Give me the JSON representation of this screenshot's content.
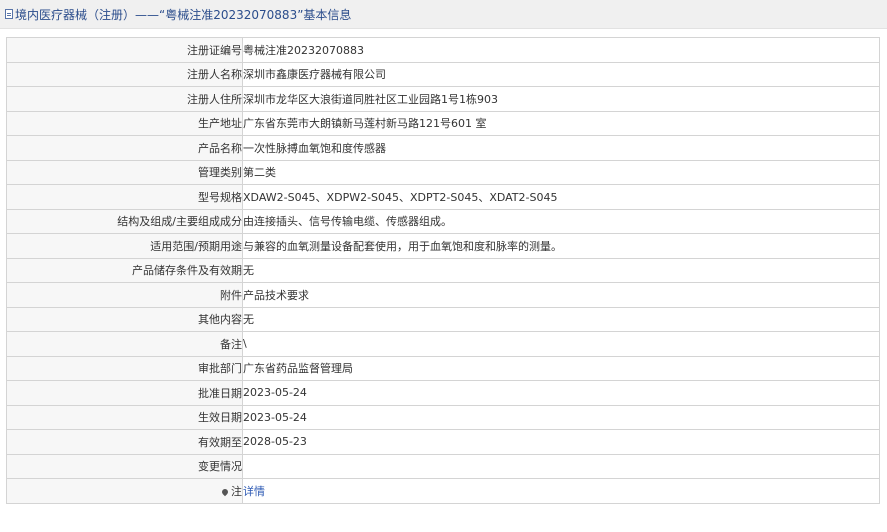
{
  "header": {
    "title": "境内医疗器械（注册）——“粤械注准20232070883”基本信息"
  },
  "rows": [
    {
      "label": "注册证编号",
      "value": "粤械注准20232070883"
    },
    {
      "label": "注册人名称",
      "value": "深圳市鑫康医疗器械有限公司"
    },
    {
      "label": "注册人住所",
      "value": "深圳市龙华区大浪街道同胜社区工业园路1号1栋903"
    },
    {
      "label": "生产地址",
      "value": "广东省东莞市大朗镇新马莲村新马路121号601 室"
    },
    {
      "label": "产品名称",
      "value": "一次性脉搏血氧饱和度传感器"
    },
    {
      "label": "管理类别",
      "value": "第二类"
    },
    {
      "label": "型号规格",
      "value": "XDAW2-S045、XDPW2-S045、XDPT2-S045、XDAT2-S045"
    },
    {
      "label": "结构及组成/主要组成成分",
      "value": "由连接插头、信号传输电缆、传感器组成。"
    },
    {
      "label": "适用范围/预期用途",
      "value": "与兼容的血氧测量设备配套使用，用于血氧饱和度和脉率的测量。"
    },
    {
      "label": "产品储存条件及有效期",
      "value": "无"
    },
    {
      "label": "附件",
      "value": "产品技术要求"
    },
    {
      "label": "其他内容",
      "value": "无"
    },
    {
      "label": "备注",
      "value": "\\"
    },
    {
      "label": "审批部门",
      "value": "广东省药品监督管理局"
    },
    {
      "label": "批准日期",
      "value": "2023-05-24"
    },
    {
      "label": "生效日期",
      "value": "2023-05-24"
    },
    {
      "label": "有效期至",
      "value": "2028-05-23"
    },
    {
      "label": "变更情况",
      "value": ""
    }
  ],
  "note_row": {
    "label": "注",
    "link_text": "详情"
  },
  "colors": {
    "header_bg": "#f0f0f0",
    "title": "#2b4d8c",
    "label_bg": "#f7f7f7",
    "border": "#d4d4d4",
    "link": "#2b58b3"
  },
  "icons": {
    "header": "document-icon",
    "note": "pin-icon"
  }
}
